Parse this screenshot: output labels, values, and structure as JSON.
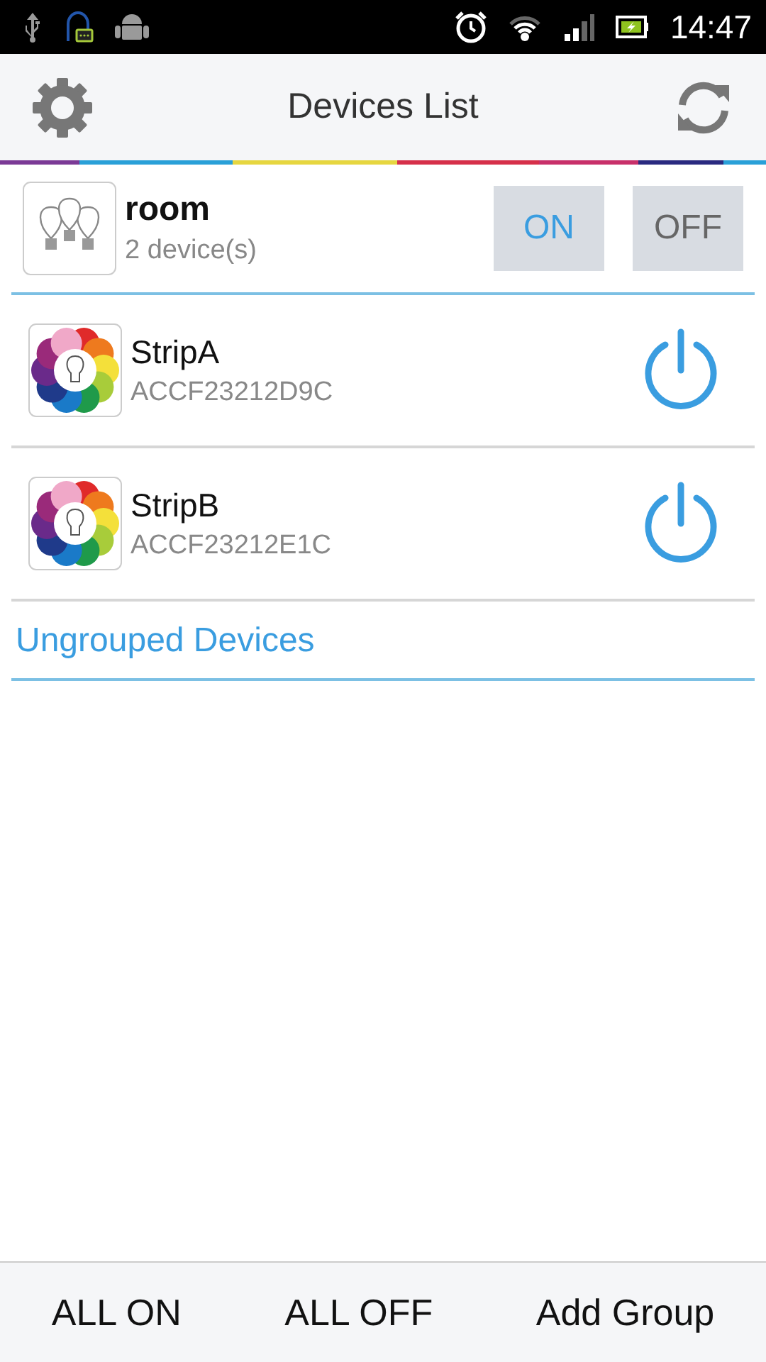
{
  "status_bar": {
    "time": "14:47"
  },
  "app_bar": {
    "title": "Devices List"
  },
  "groups": [
    {
      "name": "room",
      "count": "2 device(s)",
      "buttons": [
        "ON",
        "OFF"
      ],
      "devices": [
        {
          "name": "StripA",
          "id": "ACCF23212D9C"
        },
        {
          "name": "StripB",
          "id": "ACCF23212E1C"
        }
      ]
    }
  ],
  "ungrouped": {
    "title": "Ungrouped Devices"
  },
  "footer": {
    "buttons": [
      "ALL ON",
      "ALL OFF",
      "Add Group"
    ]
  }
}
